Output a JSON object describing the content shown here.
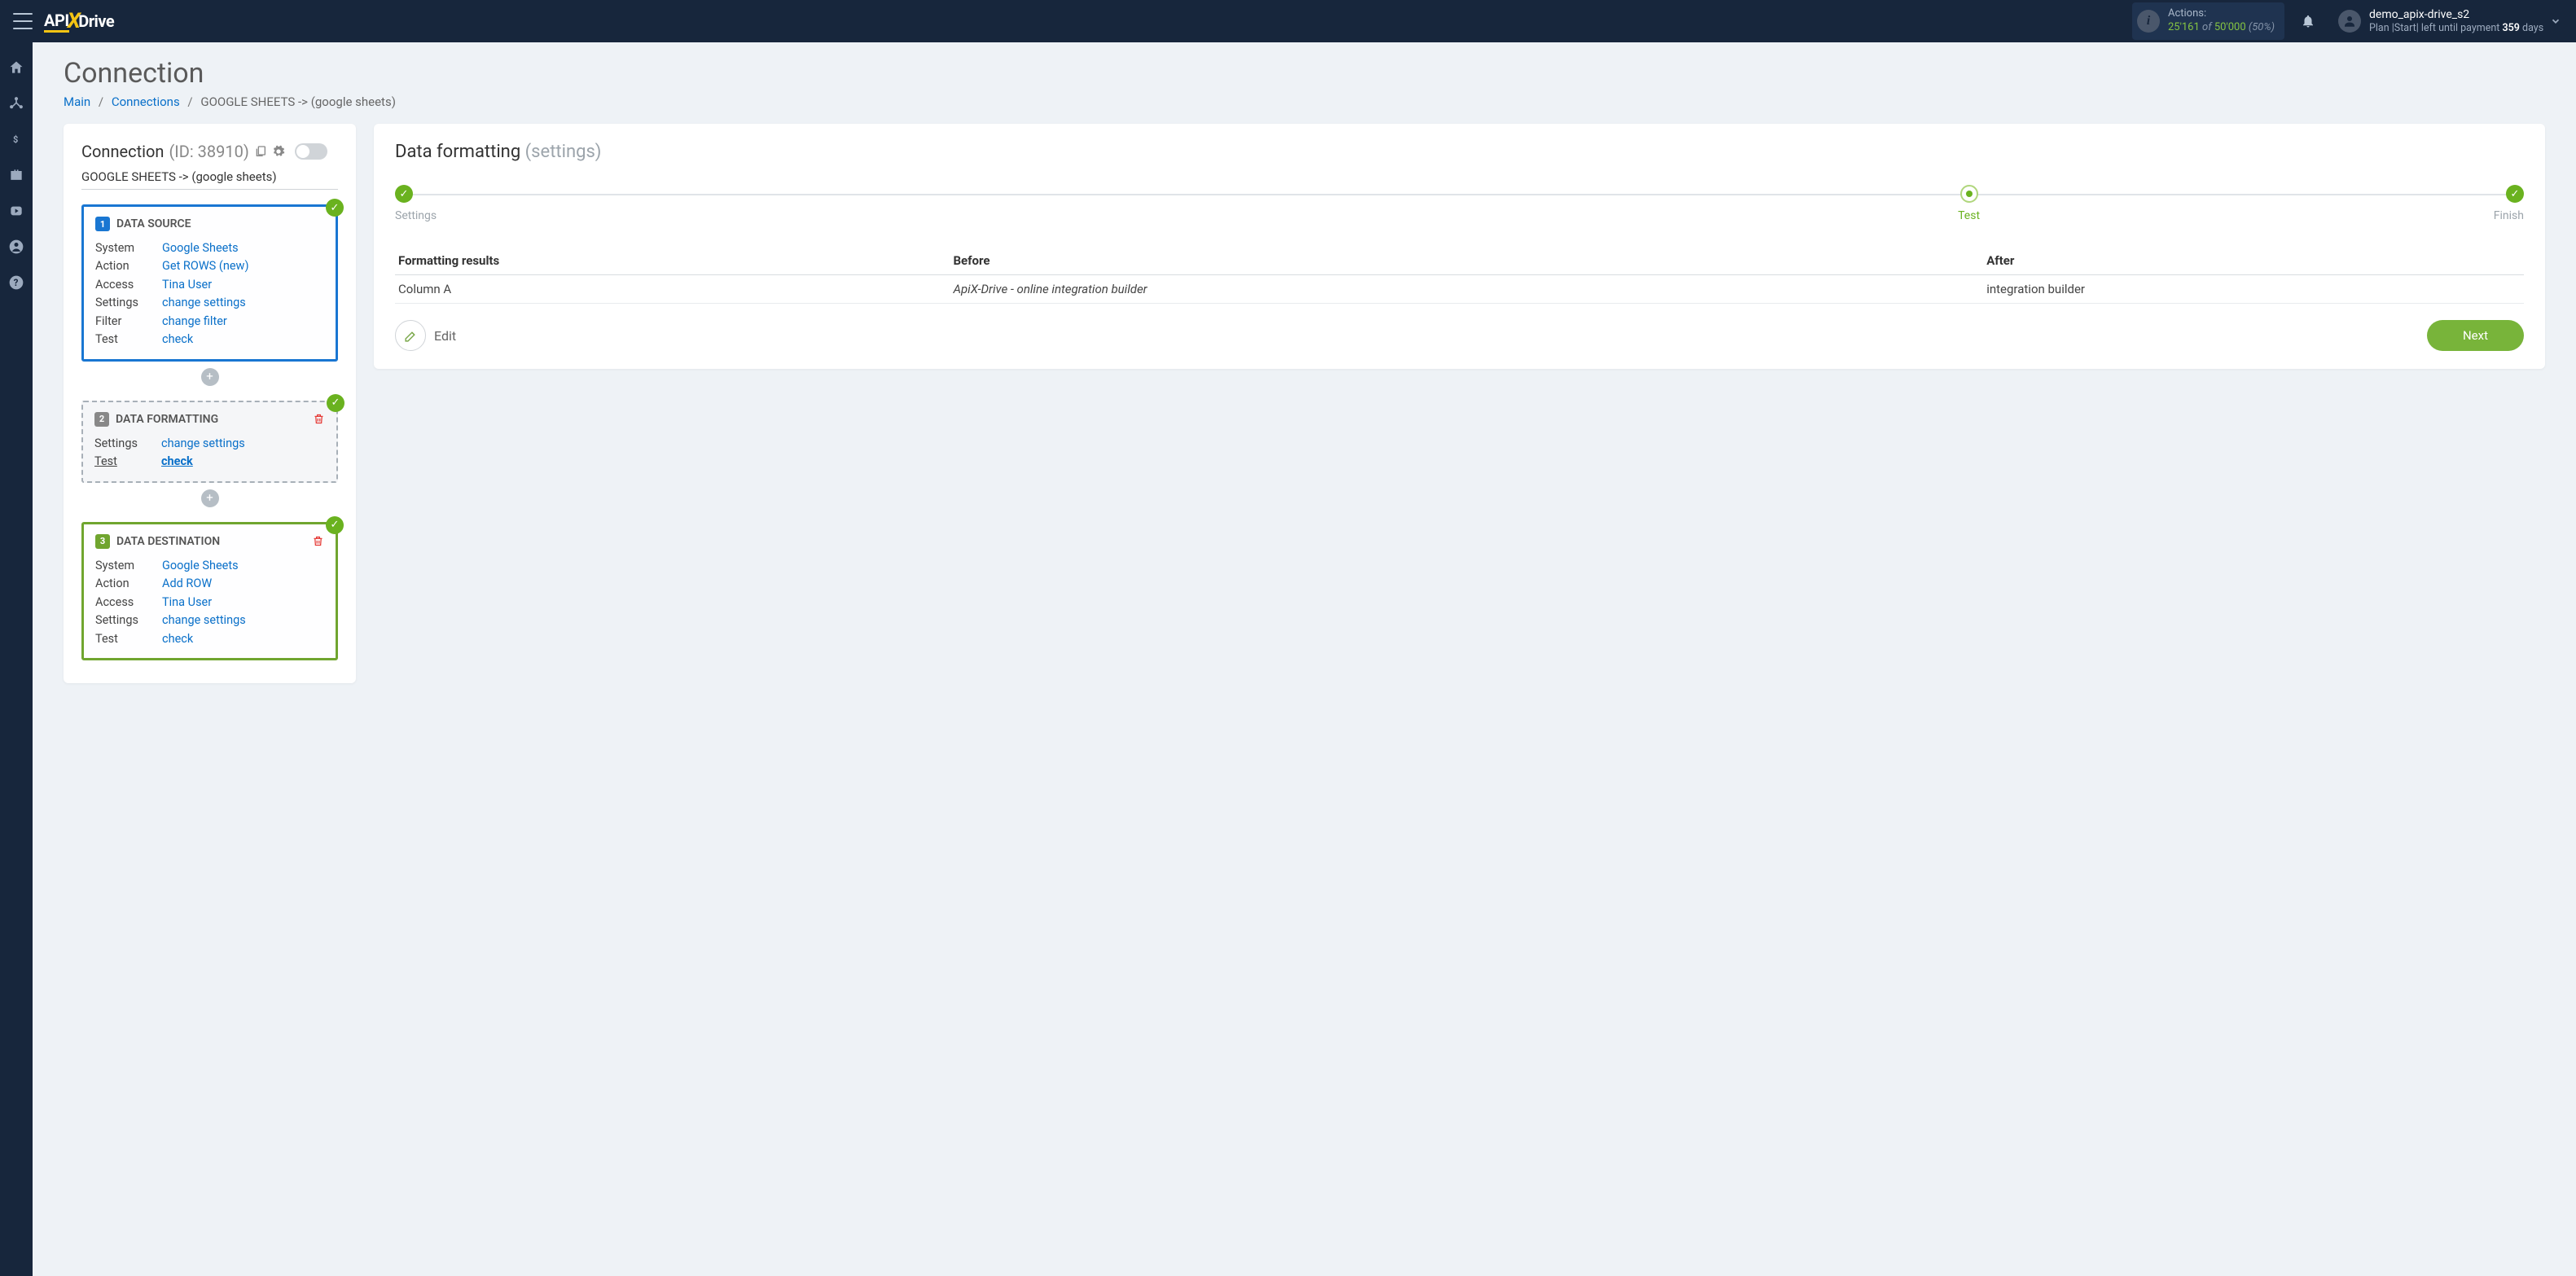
{
  "topbar": {
    "logo_api": "API",
    "logo_drive": "Drive",
    "actions_label": "Actions:",
    "actions_used": "25'161",
    "actions_of": "of",
    "actions_total": "50'000",
    "actions_pct": "(50%)"
  },
  "user": {
    "name": "demo_apix-drive_s2",
    "plan_prefix": "Plan |Start| left until payment",
    "plan_days": "359",
    "plan_suffix": "days"
  },
  "page": {
    "title": "Connection"
  },
  "breadcrumb": {
    "main": "Main",
    "connections": "Connections",
    "current": "GOOGLE SHEETS -> (google sheets)"
  },
  "left": {
    "conn_title": "Connection",
    "conn_id": "(ID: 38910)",
    "conn_sub": "GOOGLE SHEETS -> (google sheets)",
    "step1": {
      "title": "DATA SOURCE",
      "system": "System",
      "system_v": "Google Sheets",
      "action": "Action",
      "action_v": "Get ROWS (new)",
      "access": "Access",
      "access_v": "Tina User",
      "settings": "Settings",
      "settings_v": "change settings",
      "filter": "Filter",
      "filter_v": "change filter",
      "test": "Test",
      "test_v": "check"
    },
    "step2": {
      "title": "DATA FORMATTING",
      "settings": "Settings",
      "settings_v": "change settings",
      "test": "Test",
      "test_v": "check"
    },
    "step3": {
      "title": "DATA DESTINATION",
      "system": "System",
      "system_v": "Google Sheets",
      "action": "Action",
      "action_v": "Add ROW",
      "access": "Access",
      "access_v": "Tina User",
      "settings": "Settings",
      "settings_v": "change settings",
      "test": "Test",
      "test_v": "check"
    }
  },
  "right": {
    "title": "Data formatting",
    "subtitle": "(settings)",
    "stepper": {
      "settings": "Settings",
      "test": "Test",
      "finish": "Finish"
    },
    "table": {
      "h1": "Formatting results",
      "h2": "Before",
      "h3": "After",
      "r1c1": "Column A",
      "r1c2": "ApiX-Drive - online integration builder",
      "r1c3": "integration builder"
    },
    "edit": "Edit",
    "next": "Next"
  }
}
